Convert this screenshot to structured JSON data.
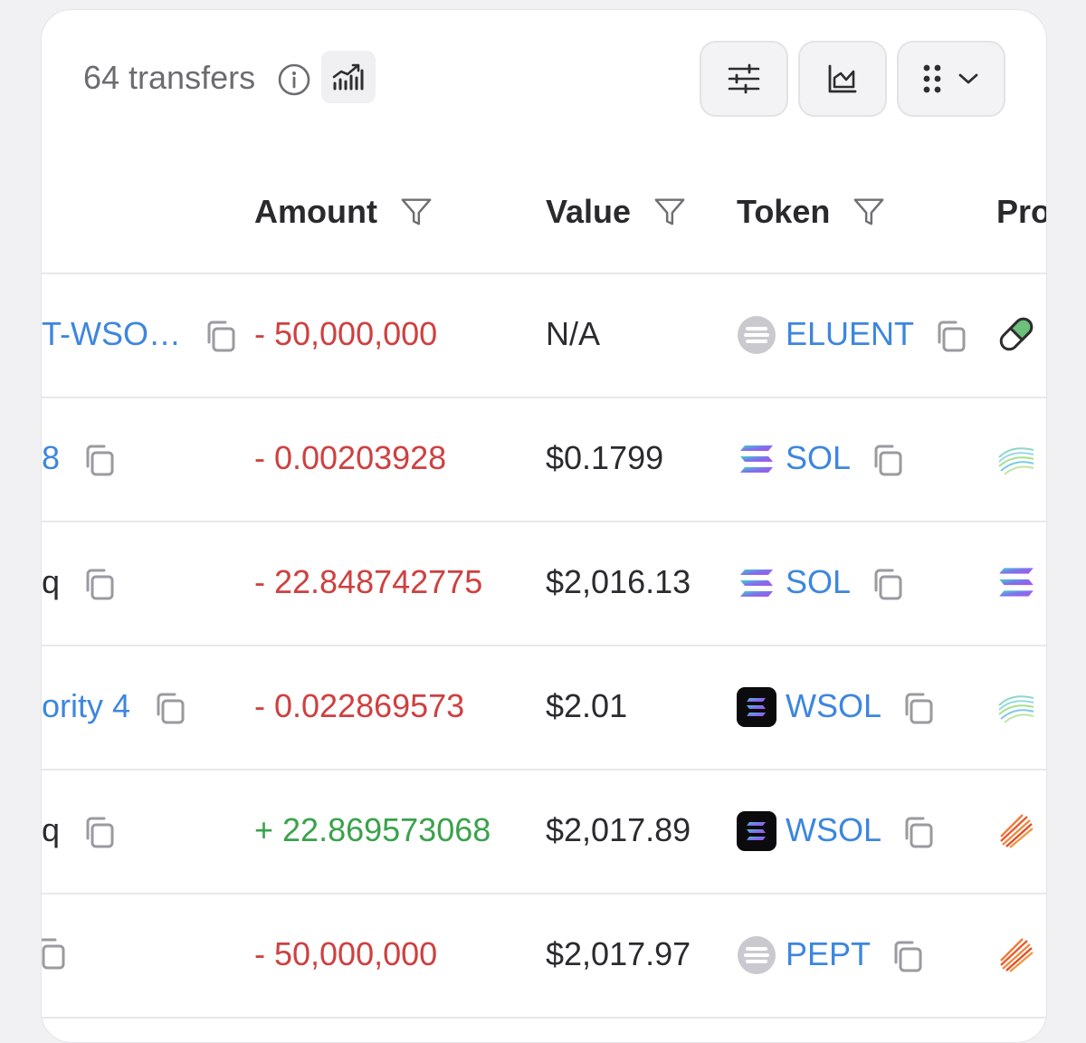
{
  "header": {
    "transfer_count": "64 transfers"
  },
  "icons": {
    "info": "info-circle-icon",
    "trend": "bar-chart-trend-icon",
    "filter": "sliders-icon",
    "chart": "area-chart-icon",
    "view": "grid-dots-icon",
    "dropdown": "chevron-down-icon",
    "copy": "copy-icon",
    "column_filter": "funnel-icon"
  },
  "table": {
    "columns": [
      "Amount",
      "Value",
      "Token",
      "Pro"
    ],
    "rows": [
      {
        "account": "T-WSO…",
        "amount": "- 50,000,000",
        "amount_sign": "neg",
        "value": "N/A",
        "token": "ELUENT",
        "token_logo": "gray-coin",
        "provider": "pill"
      },
      {
        "account": "8",
        "amount": "- 0.00203928",
        "amount_sign": "neg",
        "value": "$0.1799",
        "token": "SOL",
        "token_logo": "sol",
        "provider": "wave-teal"
      },
      {
        "account": "q",
        "amount": "- 22.848742775",
        "amount_sign": "neg",
        "value": "$2,016.13",
        "token": "SOL",
        "token_logo": "sol",
        "provider": "sol"
      },
      {
        "account": "ority 4",
        "amount": "- 0.022869573",
        "amount_sign": "neg",
        "value": "$2.01",
        "token": "WSOL",
        "token_logo": "wsol",
        "provider": "wave-teal"
      },
      {
        "account": "q",
        "amount": "+ 22.869573068",
        "amount_sign": "pos",
        "value": "$2,017.89",
        "token": "WSOL",
        "token_logo": "wsol",
        "provider": "stripes-orange"
      },
      {
        "account": "",
        "amount": "- 50,000,000",
        "amount_sign": "neg",
        "value": "$2,017.97",
        "token": "PEPT",
        "token_logo": "gray-coin",
        "provider": "stripes-orange"
      }
    ]
  },
  "colors": {
    "link": "#3d86df",
    "negative": "#cf4040",
    "positive": "#3aa24c",
    "text": "#2b2b2f"
  }
}
